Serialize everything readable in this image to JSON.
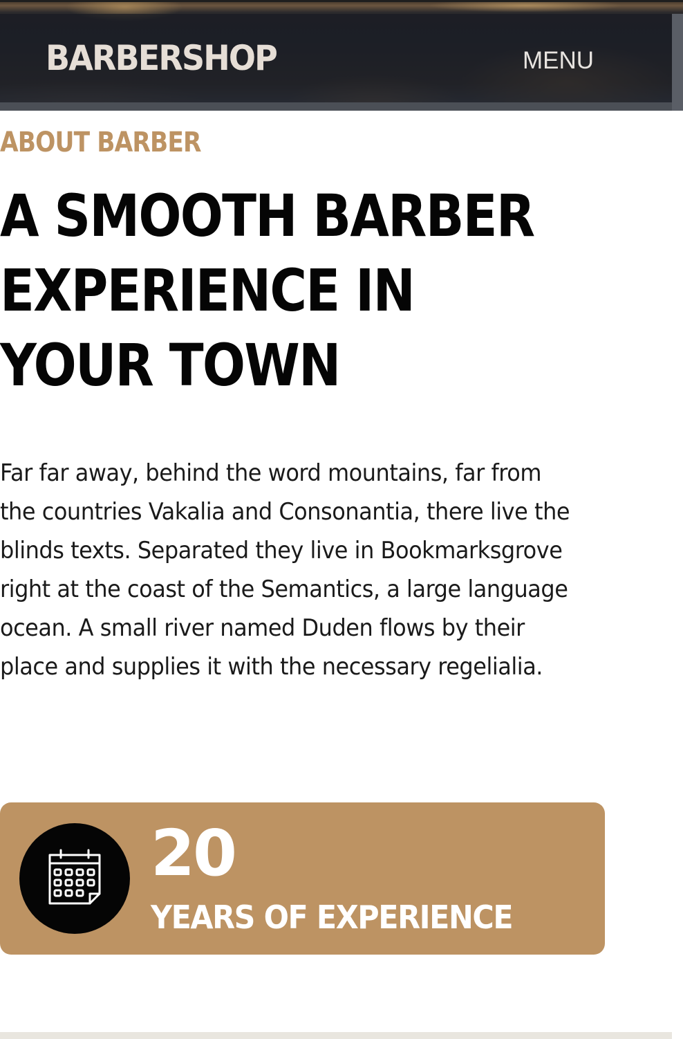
{
  "header": {
    "brand": "BARBERSHOP",
    "menu_label": "MENU"
  },
  "about": {
    "eyebrow": "ABOUT BARBER",
    "headline": "A SMOOTH BARBER EXPERIENCE IN YOUR TOWN",
    "paragraph": "Far far away, behind the word mountains, far from the countries Vakalia and Consonantia, there live the blinds texts. Separated they live in Bookmarksgrove right at the coast of the Semantics, a large language ocean. A small river named Duden flows by their place and supplies it with the necessary regelialia."
  },
  "experience": {
    "number": "20",
    "label": "YEARS OF EXPERIENCE",
    "icon": "calendar-icon"
  },
  "colors": {
    "accent": "#bd9363",
    "heading": "#050505",
    "header_bg": "#1f232b"
  }
}
